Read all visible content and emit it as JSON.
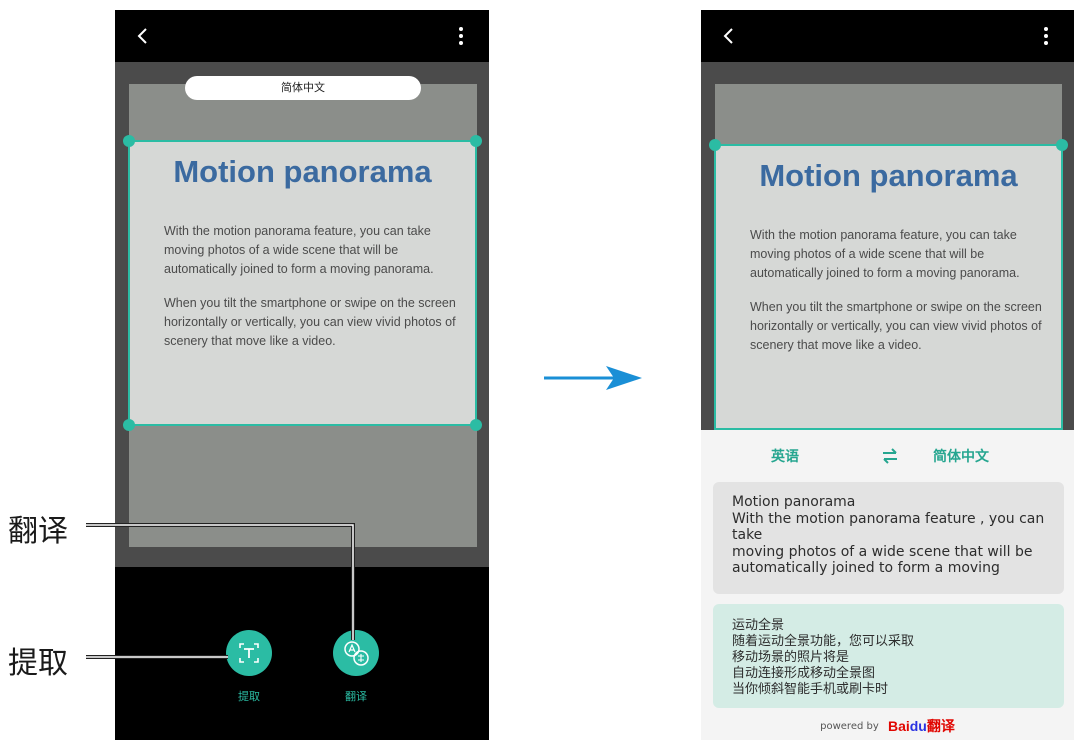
{
  "phones": {
    "left": {
      "capture_language": "简体中文",
      "doc_title": "Motion panorama",
      "doc_para1": "With the motion panorama feature, you can take moving photos of a wide scene that will be automatically joined to form a moving panorama.",
      "doc_para2": "When you tilt the smartphone or swipe on the screen horizontally or vertically, you can view vivid photos of scenery that move like a video.",
      "extract_label": "提取",
      "translate_label": "翻译"
    },
    "right": {
      "doc_title": "Motion panorama",
      "doc_para1": "With the motion panorama feature, you can take moving photos of a wide scene that will be automatically joined to form a moving panorama.",
      "doc_para2": "When you tilt the smartphone or swipe on the screen horizontally or vertically, you can view vivid photos of scenery that move like a video.",
      "source_language": "英语",
      "target_language": "简体中文",
      "source_text": "Motion panorama\nWith the motion panorama feature , you can take\nmoving photos of a wide scene that will be\nautomatically joined to form a moving",
      "translated_text": "运动全景\n随着运动全景功能，您可以采取\n移动场景的照片将是\n自动连接形成移动全景图\n当你倾斜智能手机或刷卡时",
      "powered_by": "powered by",
      "provider_logo": "Baidu翻译"
    }
  },
  "callouts": {
    "translate": "翻译",
    "extract": "提取"
  },
  "colors": {
    "accent": "#2bbca4",
    "arrow": "#1a8fd6"
  }
}
